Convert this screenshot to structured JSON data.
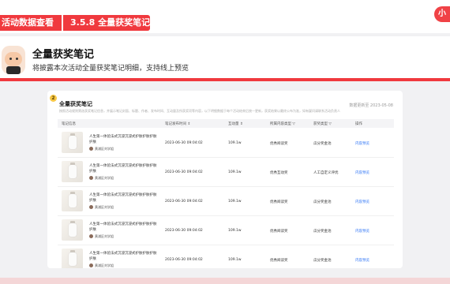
{
  "header": {
    "category_tag": "活动数据查看",
    "section_tag": "3.5.8 全量获奖笔记",
    "corner_logo": "小"
  },
  "hero": {
    "title": "全量获奖笔记",
    "subtitle": "将披露本次活动全量获奖笔记明细，支持线上预览"
  },
  "card": {
    "step": "2",
    "title": "全量获奖笔记",
    "description": "按照活动规则筛选获奖笔记信息，并展示笔记封面、标题、作者、发布时间、互动量及所获奖项等内容，以下明细数据于每个活动结束后统一更新，获奖结果以最终公布为准，如有疑问请联系活动负责人",
    "updated": "数据更新至 2023-05-08"
  },
  "table": {
    "columns": [
      "笔记信息",
      "笔记发布时间 ⇕",
      "互动量 ⇕",
      "所属内容类型 ▽",
      "获奖类型 ▽",
      "操作"
    ],
    "rows": [
      {
        "title": "人生第一体验法式沉浸沉浸式护肤护肤护肤护肤",
        "author": "黄浦区刘学姐",
        "time": "2023-06-30 09:04:02",
        "interactions": "109.1w",
        "content_type": "优秀阅读奖",
        "award": "瓜分奖金池",
        "action": "内容预览"
      },
      {
        "title": "人生第一体验法式沉浸沉浸式护肤护肤护肤护肤",
        "author": "黄浦区刘学姐",
        "time": "2023-06-30 09:04:02",
        "interactions": "109.1w",
        "content_type": "优秀互动奖",
        "award": "人工自定义评优",
        "action": "内容预览"
      },
      {
        "title": "人生第一体验法式沉浸沉浸式护肤护肤护肤护肤",
        "author": "黄浦区刘学姐",
        "time": "2023-06-30 09:04:02",
        "interactions": "109.1w",
        "content_type": "优秀阅读奖",
        "award": "瓜分奖金池",
        "action": "内容预览"
      },
      {
        "title": "人生第一体验法式沉浸沉浸式护肤护肤护肤护肤",
        "author": "黄浦区刘学姐",
        "time": "2023-06-30 09:04:02",
        "interactions": "109.1w",
        "content_type": "优秀阅读奖",
        "award": "瓜分奖金池",
        "action": "内容预览"
      },
      {
        "title": "人生第一体验法式沉浸沉浸式护肤护肤护肤护肤",
        "author": "黄浦区刘学姐",
        "time": "2023-06-30 09:04:02",
        "interactions": "109.1w",
        "content_type": "优秀阅读奖",
        "award": "瓜分奖金池",
        "action": "内容预览"
      }
    ]
  },
  "colors": {
    "accent": "#f0393e",
    "link": "#3478f6"
  }
}
